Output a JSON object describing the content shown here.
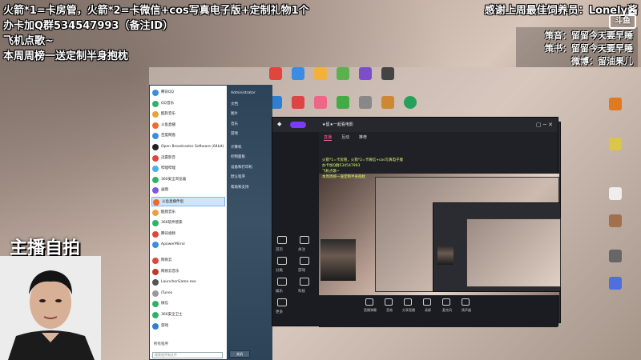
{
  "overlay": {
    "line1": "火箭*1=卡房管，火箭*2=卡微信+cos写真电子版+定制礼物1个",
    "line2": "办卡加Q群534547993（备注ID）",
    "line3": "飞机点歌~",
    "line4": "本周周榜一送定制半身抱枕",
    "thanks": "感谢上周最佳饲养员：Lonely酱",
    "credits": [
      "策音：留留今天要早睡",
      "策书：留留今天要早睡",
      "微博：留油果儿"
    ],
    "logo": "斗鱼"
  },
  "webcam": {
    "label": "主播自拍"
  },
  "start_menu": {
    "left_items": [
      "腾讯QQ",
      "QQ音乐",
      "酷狗音乐",
      "斗鱼直播",
      "百度网盘",
      "Open Broadcaster Software (64bit)",
      "迅雷影音",
      "哔哩哔哩",
      "360安全浏览器",
      "画图",
      "斗鱼直播伴侣",
      "酷我音乐",
      "360软件管家",
      "腾讯视频",
      "ApowerMirror",
      "网易云",
      "网易云音乐",
      "LauncherGame.exe",
      "iTunes",
      "微信",
      "360安全卫士",
      "游戏"
    ],
    "selected_index": 10,
    "right_items": [
      "Administrator",
      "文档",
      "图片",
      "音乐",
      "游戏",
      "计算机",
      "控制面板",
      "设备和打印机",
      "默认程序",
      "帮助和支持"
    ],
    "all_programs": "所有程序",
    "search_placeholder": "搜索程序和文件",
    "shutdown": "关机"
  },
  "app": {
    "tabs": [
      "直播",
      "互动",
      "推荐"
    ],
    "active_tab": 0,
    "room_title": "★留★一起看电影",
    "sidebar_items": [
      "首页",
      "关注",
      "分类",
      "游戏",
      "娱乐",
      "科技",
      "更多"
    ],
    "preview_overlay": [
      "火箭*1=卡房管，火箭*2=卡微信+cos写真电子版",
      "办卡加Q群534547993",
      "飞机点歌~",
      "本周周榜一送定制半身抱枕"
    ],
    "controls": [
      "直播弹幕",
      "音效",
      "分享直播",
      "录屏",
      "麦克风",
      "扬声器"
    ]
  }
}
